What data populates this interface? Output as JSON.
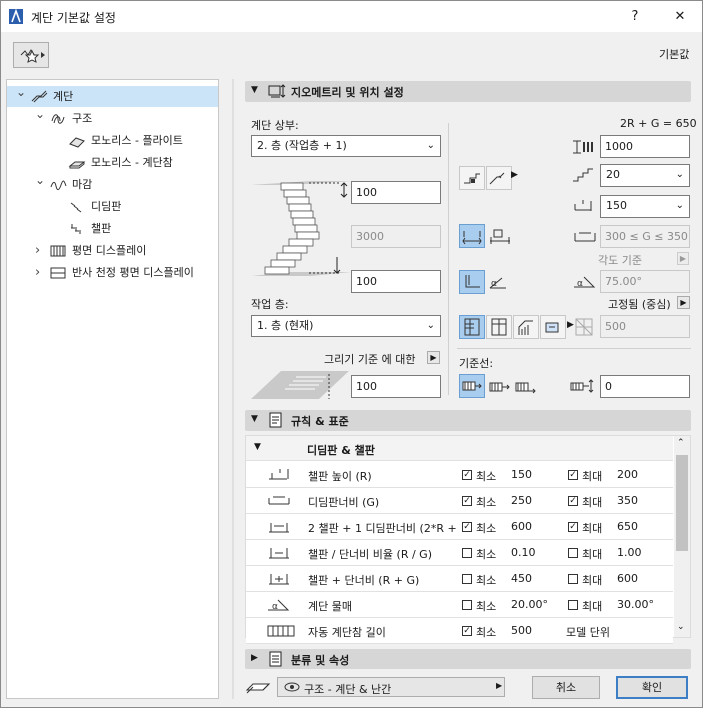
{
  "window": {
    "title": "계단 기본값 설정",
    "help": "?",
    "close": "✕"
  },
  "toolbar": {
    "defaults_label": "기본값"
  },
  "tree": [
    {
      "label": "계단",
      "indent": 0,
      "selected": true,
      "expander": "open"
    },
    {
      "label": "구조",
      "indent": 1,
      "selected": false,
      "expander": "open"
    },
    {
      "label": "모노리스 - 플라이트",
      "indent": 2,
      "selected": false,
      "expander": "none"
    },
    {
      "label": "모노리스 - 계단참",
      "indent": 2,
      "selected": false,
      "expander": "none"
    },
    {
      "label": "마감",
      "indent": 1,
      "selected": false,
      "expander": "open"
    },
    {
      "label": "디딤판",
      "indent": 2,
      "selected": false,
      "expander": "none"
    },
    {
      "label": "챌판",
      "indent": 2,
      "selected": false,
      "expander": "none"
    },
    {
      "label": "평면 디스플레이",
      "indent": 1,
      "selected": false,
      "expander": "closed"
    },
    {
      "label": "반사 천정 평면 디스플레이",
      "indent": 1,
      "selected": false,
      "expander": "closed"
    }
  ],
  "geometry": {
    "section_title": "지오메트리 및 위치 설정",
    "top_label": "계단 상부:",
    "top_value": "2. 층 (작업층 + 1)",
    "top_offset": "100",
    "total_height": "3000",
    "bottom_offset": "100",
    "home_story_label": "작업 층:",
    "home_story_value": "1. 층 (현재)",
    "relative_label": "그리기 기준 에 대한",
    "relative_value": "100",
    "formula": "2R + G = 650",
    "total_rise": "1000",
    "risers": "20",
    "riser_height": "150",
    "going_range": "300 ≤ G ≤ 350",
    "angle_basis": "각도 기준",
    "angle": "75.00°",
    "fixed_label": "고정됨 (중심)",
    "width_value": "500",
    "baseline_label": "기준선:",
    "baseline_offset": "0"
  },
  "rules": {
    "section_title": "규칙 & 표준",
    "group_title": "디딤판 & 챌판",
    "min_label": "최소",
    "max_label": "최대",
    "rows": [
      {
        "name": "챌판 높이 (R)",
        "min_checked": true,
        "min": "150",
        "max_checked": true,
        "max": "200"
      },
      {
        "name": "디딤판너비 (G)",
        "min_checked": true,
        "min": "250",
        "max_checked": true,
        "max": "350"
      },
      {
        "name": "2 챌판 + 1 디딤판너비 (2*R +",
        "min_checked": true,
        "min": "600",
        "max_checked": true,
        "max": "650"
      },
      {
        "name": "챌판 / 단너비 비율 (R / G)",
        "min_checked": false,
        "min": "0.10",
        "max_checked": false,
        "max": "1.00"
      },
      {
        "name": "챌판 + 단너비 (R + G)",
        "min_checked": false,
        "min": "450",
        "max_checked": false,
        "max": "600"
      },
      {
        "name": "계단 물매",
        "min_checked": false,
        "min": "20.00°",
        "max_checked": false,
        "max": "30.00°"
      },
      {
        "name": "자동 계단참 길이",
        "min_checked": true,
        "min": "500",
        "max_checked": null,
        "max": "모델 단위"
      }
    ]
  },
  "classification": {
    "section_title": "분류 및 속성"
  },
  "footer": {
    "layer": "구조 - 계단 & 난간",
    "cancel": "취소",
    "ok": "확인"
  }
}
